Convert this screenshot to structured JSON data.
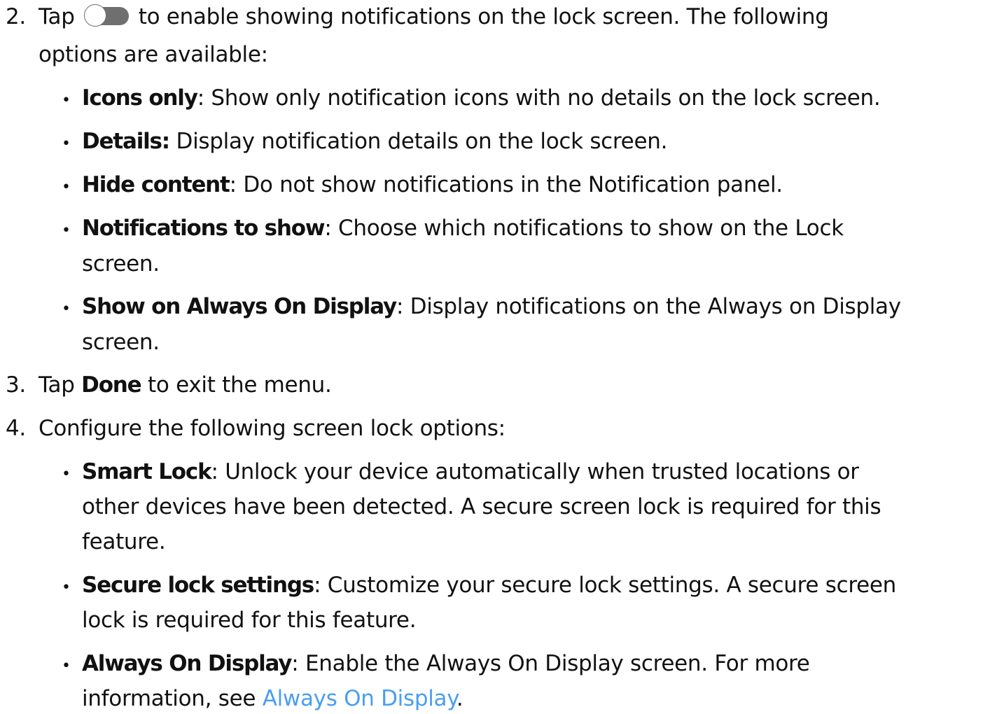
{
  "step2": {
    "number": "2.",
    "text_before_toggle": "Tap",
    "toggle_icon": "toggle-switch-icon",
    "text_after_toggle": "to enable showing notifications on the lock screen. The following",
    "text_line2": "options are available:",
    "options": [
      {
        "term": "Icons only",
        "desc": ": Show only notification icons with no details on the lock screen."
      },
      {
        "term": "Details:",
        "desc": " Display notification details on the lock screen."
      },
      {
        "term": "Hide content",
        "desc": ": Do not show notifications in the Notification panel."
      },
      {
        "term": "Notifications to show",
        "desc": ": Choose which notifications to show on the Lock",
        "desc2": "screen."
      },
      {
        "term": "Show on Always On Display",
        "desc": ": Display notifications on the Always on Display",
        "desc2": "screen."
      }
    ]
  },
  "step3": {
    "number": "3.",
    "text_before": "Tap",
    "term": "Done",
    "text_after": "to exit the menu."
  },
  "step4": {
    "number": "4.",
    "text": "Configure the following screen lock options:",
    "options": [
      {
        "term": "Smart Lock",
        "desc": ": Unlock your device automatically when trusted locations or",
        "desc2": "other devices have been detected. A secure screen lock is required for this",
        "desc3": "feature."
      },
      {
        "term": "Secure lock settings",
        "desc": ": Customize your secure lock settings. A secure screen",
        "desc2": "lock is required for this feature."
      },
      {
        "term": "Always On Display",
        "desc": ": Enable the Always On Display screen. For more",
        "desc2_before_link": "information, see ",
        "link": "Always On Display",
        "desc2_after_link": "."
      }
    ]
  },
  "bullet_char": "•",
  "colors": {
    "text": "#111111",
    "link": "#4a9ef0",
    "toggle": "#6f6f6f"
  }
}
